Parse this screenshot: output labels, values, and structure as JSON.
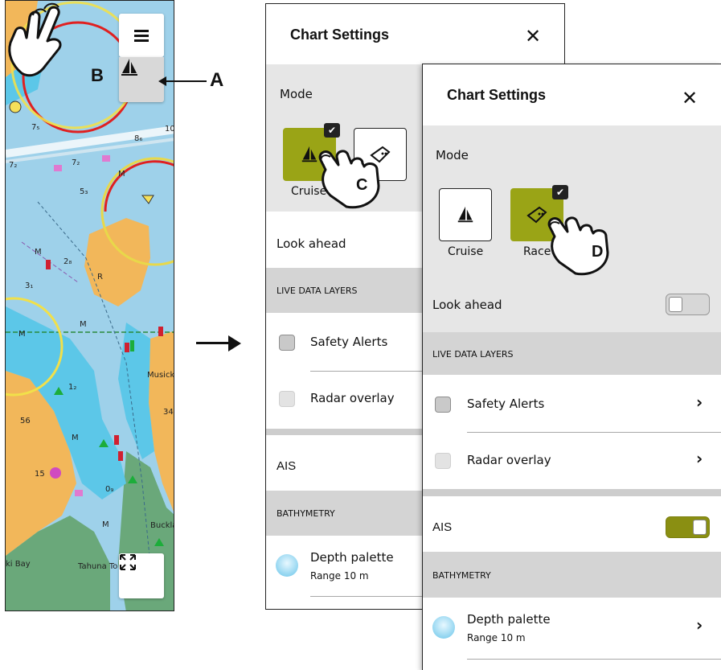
{
  "callouts": {
    "a": "A",
    "b": "B",
    "c": "C",
    "d": "D"
  },
  "map": {
    "labels": {
      "musick": "Musick Po",
      "buckland": "Buckla",
      "bay": "ki Bay",
      "tahuna": "Tahuna To"
    },
    "depths": [
      "7₅",
      "8₆",
      "7₂",
      "7₂",
      "5₃",
      "2₈",
      "3₁",
      "1₂",
      "56",
      "15",
      "0₉",
      "34",
      "10",
      "9"
    ],
    "marks": [
      "M",
      "M",
      "M",
      "M",
      "M",
      "M",
      "R"
    ]
  },
  "back_panel": {
    "title": "Chart Settings",
    "mode_label": "Mode",
    "cruise_label": "Cruise",
    "race_label": "e",
    "look_ahead": "Look ahead",
    "live_data_layers": "LIVE DATA LAYERS",
    "safety_alerts": "Safety Alerts",
    "radar_overlay": "Radar overlay",
    "ais": "AIS",
    "bathymetry": "BATHYMETRY",
    "depth_palette": "Depth palette",
    "range": "Range 10 m"
  },
  "front_panel": {
    "title": "Chart Settings",
    "mode_label": "Mode",
    "cruise_label": "Cruise",
    "race_label": "Race",
    "look_ahead": "Look ahead",
    "live_data_layers": "LIVE DATA LAYERS",
    "safety_alerts": "Safety Alerts",
    "radar_overlay": "Radar overlay",
    "ais": "AIS",
    "bathymetry": "BATHYMETRY",
    "depth_palette": "Depth palette",
    "range": "Range 10 m",
    "look_ahead_enabled": false,
    "ais_enabled": true,
    "selected_mode": "Race"
  },
  "colors": {
    "active_mode": "#9aa416",
    "toggle_on": "#8a8f12",
    "section_bg": "#d4d4d4",
    "water": "#9ed1ea",
    "land": "#f2b75a",
    "shallow": "#5cc7e8"
  },
  "icons": [
    "menu-icon",
    "sailboat-icon",
    "race-flag-icon",
    "close-icon",
    "chevron-right-icon",
    "fullscreen-icon",
    "check-icon",
    "pointing-hand-icon"
  ]
}
